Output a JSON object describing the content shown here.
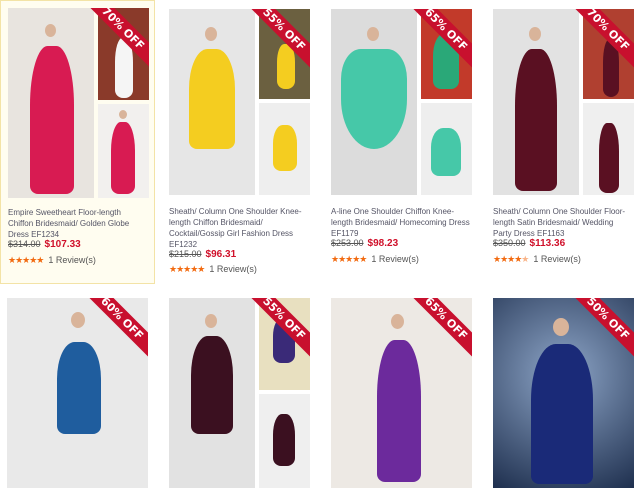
{
  "products": [
    {
      "ribbon": "70% OFF",
      "title": "Empire Sweetheart Floor-length Chiffon Bridesmaid/ Golden Globe Dress EF1234",
      "old_price": "$314.00",
      "new_price": "$107.33",
      "stars": "★★★★★",
      "reviews": "1 Review(s)",
      "color": "#d81b52"
    },
    {
      "ribbon": "55% OFF",
      "title": "Sheath/ Column One Shoulder Knee-length Chiffon Bridesmaid/ Cocktail/Gossip Girl Fashion Dress EF1232",
      "old_price": "$215.00",
      "new_price": "$96.31",
      "stars": "★★★★★",
      "reviews": "1 Review(s)",
      "color": "#f4cd20"
    },
    {
      "ribbon": "65% OFF",
      "title": "A-line One Shoulder Chiffon Knee-length Bridesmaid/ Homecoming Dress EF1179",
      "old_price": "$253.00",
      "new_price": "$98.23",
      "stars": "★★★★★",
      "reviews": "1 Review(s)",
      "color": "#46c8a8"
    },
    {
      "ribbon": "70% OFF",
      "title": "Sheath/ Column One Shoulder Floor-length Satin Bridesmaid/ Wedding Party Dress EF1163",
      "old_price": "$350.00",
      "new_price": "$113.36",
      "stars": "★★★★",
      "stars_empty": "★",
      "reviews": "1 Review(s)",
      "color": "#5a1022"
    },
    {
      "ribbon": "60% OFF",
      "color": "#1f5d9e"
    },
    {
      "ribbon": "55% OFF",
      "color": "#3b1020"
    },
    {
      "ribbon": "65% OFF",
      "color": "#6c2a9c"
    },
    {
      "ribbon": "50% OFF",
      "color": "#1a2a78"
    }
  ]
}
